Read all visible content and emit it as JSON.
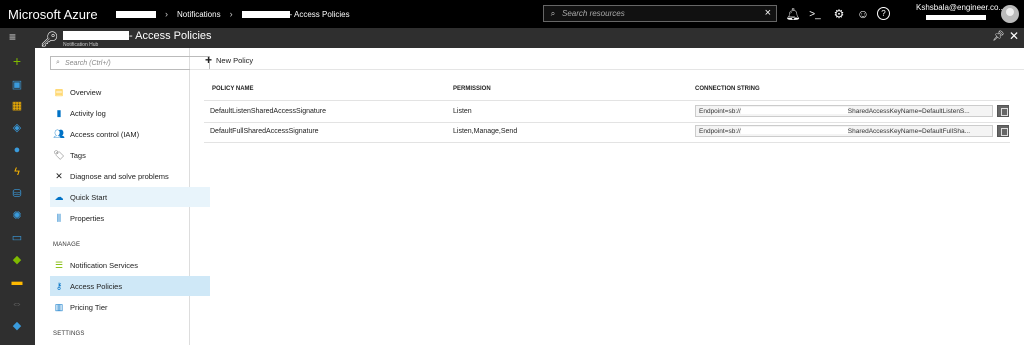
{
  "topbar": {
    "brand": "Microsoft Azure",
    "crumbs": [
      "Notifications",
      "- Access Policies"
    ],
    "search_placeholder": "Search resources",
    "account_email": "Kshsbala@engineer.co..."
  },
  "blade": {
    "title": "- Access Policies",
    "subtitle": "Notification Hub"
  },
  "menu": {
    "search_placeholder": "Search (Ctrl+/)",
    "items": [
      {
        "label": "Overview",
        "icon": "overview-icon"
      },
      {
        "label": "Activity log",
        "icon": "activity-log-icon"
      },
      {
        "label": "Access control (IAM)",
        "icon": "iam-icon"
      },
      {
        "label": "Tags",
        "icon": "tag-icon"
      },
      {
        "label": "Diagnose and solve problems",
        "icon": "wrench-icon"
      },
      {
        "label": "Quick Start",
        "icon": "quickstart-icon"
      },
      {
        "label": "Properties",
        "icon": "properties-icon"
      }
    ],
    "section_manage": "MANAGE",
    "manage_items": [
      {
        "label": "Notification Services",
        "icon": "notification-services-icon"
      },
      {
        "label": "Access Policies",
        "icon": "key-icon"
      },
      {
        "label": "Pricing Tier",
        "icon": "pricing-tier-icon"
      }
    ],
    "section_settings": "SETTINGS"
  },
  "content": {
    "new_policy": "New Policy",
    "columns": [
      "POLICY NAME",
      "PERMISSION",
      "CONNECTION STRING"
    ],
    "rows": [
      {
        "name": "DefaultListenSharedAccessSignature",
        "permission": "Listen",
        "conn_prefix": "Endpoint=sb://",
        "conn_suffix": "SharedAccessKeyName=DefaultListenS..."
      },
      {
        "name": "DefaultFullSharedAccessSignature",
        "permission": "Listen,Manage,Send",
        "conn_prefix": "Endpoint=sb://",
        "conn_suffix": "SharedAccessKeyName=DefaultFullSha..."
      }
    ]
  },
  "colors": {
    "topbar": "#000000",
    "bladehead": "#2f2f2f",
    "selected": "#cfe8f7",
    "accent": "#0072c6"
  }
}
